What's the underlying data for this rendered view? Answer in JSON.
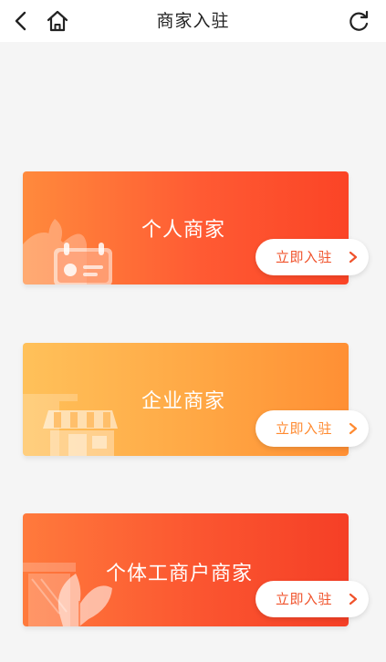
{
  "header": {
    "title": "商家入驻",
    "back_icon": "chevron-left-icon",
    "home_icon": "home-icon",
    "refresh_icon": "refresh-icon"
  },
  "cards": [
    {
      "label": "个人商家",
      "button": "立即入驻",
      "accent": "#f0522b",
      "decor_icon": "id-card-icon"
    },
    {
      "label": "企业商家",
      "button": "立即入驻",
      "accent": "#ff8a30",
      "decor_icon": "storefront-icon"
    },
    {
      "label": "个体工商户商家",
      "button": "立即入驻",
      "accent": "#f0522b",
      "decor_icon": "shop-plant-icon"
    }
  ],
  "colors": {
    "background": "#f5f5f5",
    "card1": "#ff5a33",
    "card2": "#ffa744",
    "card3": "#fb5530"
  }
}
